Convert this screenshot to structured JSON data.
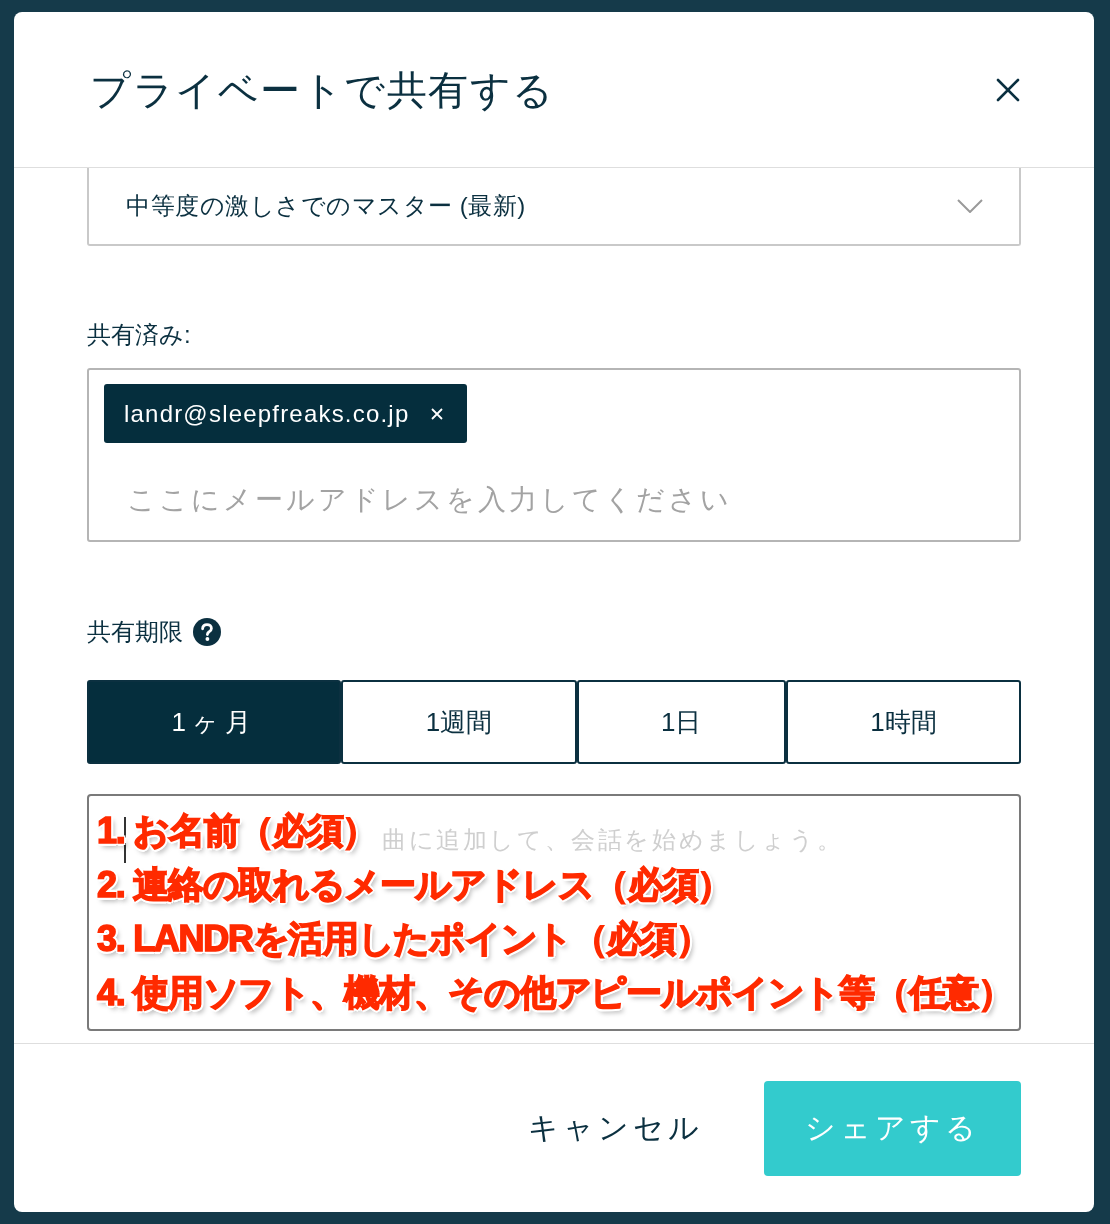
{
  "dialog": {
    "title": "プライベートで共有する"
  },
  "version_select": {
    "value": "中等度の激しさでのマスター (最新)"
  },
  "shared_with": {
    "label": "共有済み:",
    "recipients": [
      {
        "email": "landr@sleepfreaks.co.jp"
      }
    ],
    "placeholder": "ここにメールアドレスを入力してください"
  },
  "expiry": {
    "label": "共有期限",
    "options": [
      {
        "label": "1ヶ月",
        "selected": true
      },
      {
        "label": "1週間",
        "selected": false
      },
      {
        "label": "1日",
        "selected": false
      },
      {
        "label": "1時間",
        "selected": false
      }
    ]
  },
  "comment": {
    "placeholder": "曲に追加して、会話を始めましょう。"
  },
  "annotation": {
    "lines": [
      "1. お名前（必須）",
      "2. 連絡の取れるメールアドレス（必須）",
      "3. LANDRを活用したポイント（必須）",
      "4. 使用ソフト、機材、その他アピールポイント等（任意）"
    ]
  },
  "buttons": [
    {
      "label": "キャンセル",
      "kind": "text"
    },
    {
      "label": "シェアする",
      "kind": "primary"
    }
  ]
}
